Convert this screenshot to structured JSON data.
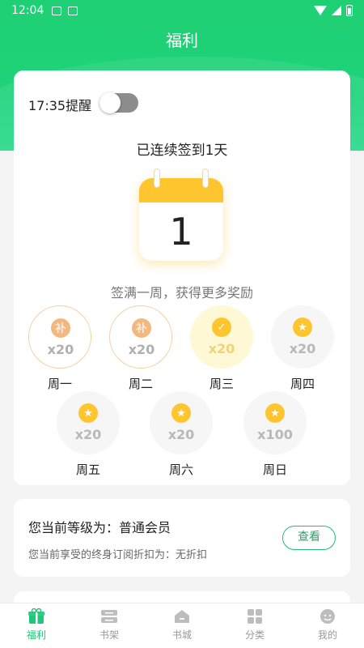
{
  "status_bar": {
    "time": "12:04"
  },
  "header": {
    "title": "福利"
  },
  "reminder": {
    "label": "17:35提醒",
    "enabled": false
  },
  "streak": {
    "text": "已连续签到1天",
    "day_number": "1"
  },
  "week": {
    "subtitle": "签满一周，获得更多奖励",
    "days": [
      {
        "label": "周一",
        "amount": "x20",
        "state": "make-up",
        "badge": "补"
      },
      {
        "label": "周二",
        "amount": "x20",
        "state": "make-up",
        "badge": "补"
      },
      {
        "label": "周三",
        "amount": "x20",
        "state": "checked",
        "badge": "✓"
      },
      {
        "label": "周四",
        "amount": "x20",
        "state": "pending",
        "badge": "★"
      },
      {
        "label": "周五",
        "amount": "x20",
        "state": "pending",
        "badge": "★"
      },
      {
        "label": "周六",
        "amount": "x20",
        "state": "pending",
        "badge": "★"
      },
      {
        "label": "周日",
        "amount": "x100",
        "state": "pending",
        "badge": "★"
      }
    ]
  },
  "membership": {
    "title": "您当前等级为：普通会员",
    "description": "您当前享受的终身订阅折扣为：无折扣",
    "view_label": "查看"
  },
  "tabs": [
    {
      "label": "福利",
      "icon": "gift-icon",
      "active": true
    },
    {
      "label": "书架",
      "icon": "bookshelf-icon",
      "active": false
    },
    {
      "label": "书城",
      "icon": "bookstore-icon",
      "active": false
    },
    {
      "label": "分类",
      "icon": "category-icon",
      "active": false
    },
    {
      "label": "我的",
      "icon": "profile-icon",
      "active": false
    }
  ],
  "colors": {
    "brand": "#1fcf73",
    "coin": "#ffc52e",
    "makeup": "#f3b880"
  }
}
